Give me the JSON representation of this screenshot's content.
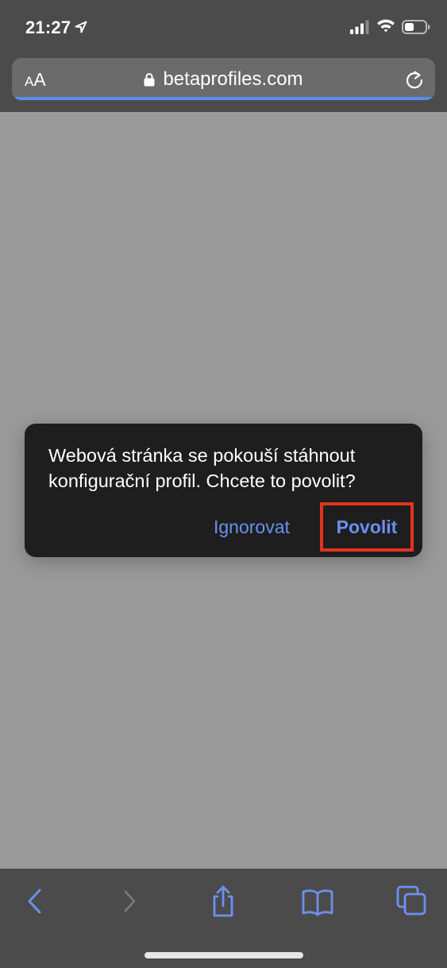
{
  "status_bar": {
    "time": "21:27"
  },
  "address_bar": {
    "text_size_small": "A",
    "text_size_large": "A",
    "url": "betaprofiles.com",
    "load_progress": 1.0
  },
  "dialog": {
    "message": "Webová stránka se pokouší stáhnout konfigurační profil. Chcete to povolit?",
    "ignore_label": "Ignorovat",
    "allow_label": "Povolit",
    "highlight_color": "#e0341e"
  },
  "colors": {
    "accent": "#6d8ff0",
    "chrome_background": "#4b4b4b",
    "page_background": "#9a9a9a",
    "dialog_background": "#1e1e1f"
  },
  "toolbar": {
    "icons": [
      "back-icon",
      "forward-icon",
      "share-icon",
      "bookmarks-icon",
      "tabs-icon"
    ]
  }
}
